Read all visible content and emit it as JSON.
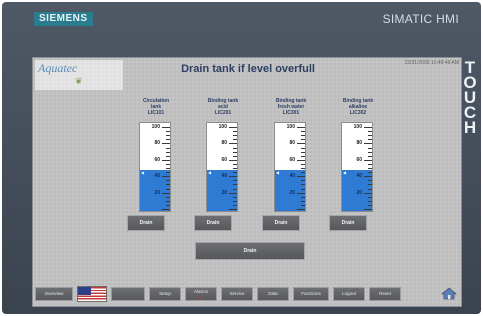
{
  "device": {
    "brand": "SIEMENS",
    "product": "SIMATIC HMI",
    "side_label": "TOUCH"
  },
  "screen": {
    "logo_text": "Aquatec",
    "title": "Drain tank if level overfull",
    "datetime": "12/31/2000 10:49:49 AM"
  },
  "tanks": [
    {
      "label_line1": "Circulation",
      "label_line2": "tank",
      "label_line3": "LIC101",
      "level_percent": 45,
      "drain_label": "Drain"
    },
    {
      "label_line1": "Binding tank",
      "label_line2": "acid",
      "label_line3": "LIC201",
      "level_percent": 45,
      "drain_label": "Drain"
    },
    {
      "label_line1": "Binding tank",
      "label_line2": "fresh water",
      "label_line3": "LIC301",
      "level_percent": 45,
      "drain_label": "Drain"
    },
    {
      "label_line1": "Binding tank",
      "label_line2": "alkaline",
      "label_line3": "LIC302",
      "level_percent": 45,
      "drain_label": "Drain"
    }
  ],
  "gauge_scale": {
    "min": 0,
    "max": 100,
    "labels": [
      "100",
      "80",
      "60",
      "40",
      "20"
    ]
  },
  "drain_all_label": "Drain",
  "nav": {
    "overview": "Overview",
    "setup": "Setup",
    "alarms": "Alarms",
    "service": "Service",
    "data": "Data",
    "functions": "Functions",
    "logout": "Logout",
    "reset": "Reset"
  },
  "colors": {
    "liquid": "#2f7bd4",
    "title": "#2e3f63",
    "bezel": "#46505c"
  }
}
